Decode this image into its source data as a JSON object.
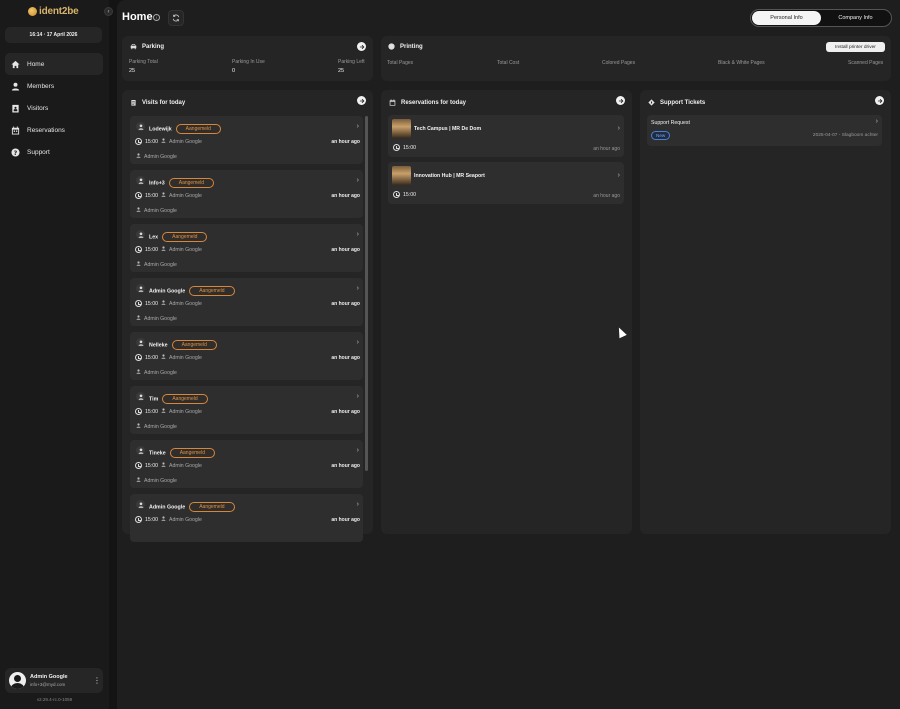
{
  "app": {
    "logo_text": "ident2be"
  },
  "sidebar": {
    "datetime": "16:14  ·  17 April 2026",
    "items": [
      {
        "label": "Home",
        "icon": "home-icon",
        "active": true
      },
      {
        "label": "Members",
        "icon": "person-icon"
      },
      {
        "label": "Visitors",
        "icon": "badge-icon"
      },
      {
        "label": "Reservations",
        "icon": "calendar-icon"
      },
      {
        "label": "Support",
        "icon": "help-icon"
      }
    ],
    "user": {
      "name": "Admin Google",
      "email": "info+3@myd.com"
    },
    "version": "v2.29.4-rc.0-1059"
  },
  "header": {
    "title": "Home",
    "toggle": {
      "personal": "Personal Info",
      "company": "Company Info",
      "selected": "personal"
    }
  },
  "parking": {
    "title": "Parking",
    "stats": [
      {
        "label": "Parking Total",
        "value": "25"
      },
      {
        "label": "Parking In Use",
        "value": "0"
      },
      {
        "label": "Parking Left",
        "value": "25"
      }
    ]
  },
  "printing": {
    "title": "Printing",
    "install_label": "Install printer driver",
    "stats": [
      {
        "label": "Total Pages"
      },
      {
        "label": "Total Cost"
      },
      {
        "label": "Colored Pages"
      },
      {
        "label": "Black & White Pages"
      },
      {
        "label": "Scanned Pages"
      }
    ]
  },
  "visits": {
    "title": "Visits for today",
    "items": [
      {
        "name": "Lodewijk",
        "status": "Aangemeld",
        "time": "15:00",
        "host": "Admin Google",
        "ago": "an hour ago",
        "creator": "Admin Google"
      },
      {
        "name": "Info+3",
        "status": "Aangemeld",
        "time": "15:00",
        "host": "Admin Google",
        "ago": "an hour ago",
        "creator": "Admin Google"
      },
      {
        "name": "Lex",
        "status": "Aangemeld",
        "time": "15:00",
        "host": "Admin Google",
        "ago": "an hour ago",
        "creator": "Admin Google"
      },
      {
        "name": "Admin Google",
        "status": "Aangemeld",
        "time": "15:00",
        "host": "Admin Google",
        "ago": "an hour ago",
        "creator": "Admin Google"
      },
      {
        "name": "Nelleke",
        "status": "Aangemeld",
        "time": "15:00",
        "host": "Admin Google",
        "ago": "an hour ago",
        "creator": "Admin Google"
      },
      {
        "name": "Tim",
        "status": "Aangemeld",
        "time": "15:00",
        "host": "Admin Google",
        "ago": "an hour ago",
        "creator": "Admin Google"
      },
      {
        "name": "Tineke",
        "status": "Aangemeld",
        "time": "15:00",
        "host": "Admin Google",
        "ago": "an hour ago",
        "creator": "Admin Google"
      },
      {
        "name": "Admin Google",
        "status": "Aangemeld",
        "time": "15:00",
        "host": "Admin Google",
        "ago": "an hour ago"
      }
    ]
  },
  "reservations": {
    "title": "Reservations for today",
    "items": [
      {
        "name": "Tech Campus | MR De Dom",
        "time": "15:00",
        "ago": "an hour ago"
      },
      {
        "name": "Innovation Hub | MR Seaport",
        "time": "15:00",
        "ago": "an hour ago"
      }
    ]
  },
  "tickets": {
    "title": "Support Tickets",
    "items": [
      {
        "title": "Support Request",
        "status": "New",
        "meta": "2025-04-07 - Slagboom achter"
      }
    ]
  }
}
